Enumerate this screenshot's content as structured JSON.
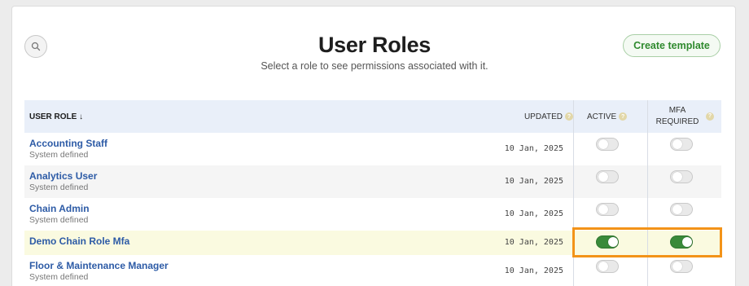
{
  "header": {
    "title": "User Roles",
    "subtitle": "Select a role to see permissions associated with it.",
    "create_label": "Create template"
  },
  "table": {
    "col_role": "USER ROLE ↓",
    "col_updated": "UPDATED",
    "col_active": "ACTIVE",
    "col_mfa_line1": "MFA",
    "col_mfa_line2": "REQUIRED",
    "help_glyph": "?",
    "rows": [
      {
        "name": "Accounting Staff",
        "sub": "System defined",
        "updated": "10 Jan, 2025",
        "active": false,
        "mfa": false
      },
      {
        "name": "Analytics User",
        "sub": "System defined",
        "updated": "10 Jan, 2025",
        "active": false,
        "mfa": false
      },
      {
        "name": "Chain Admin",
        "sub": "System defined",
        "updated": "10 Jan, 2025",
        "active": false,
        "mfa": false
      },
      {
        "name": "Demo Chain Role Mfa",
        "sub": "",
        "updated": "10 Jan, 2025",
        "active": true,
        "mfa": true
      },
      {
        "name": "Floor & Maintenance Manager",
        "sub": "System defined",
        "updated": "10 Jan, 2025",
        "active": false,
        "mfa": false
      }
    ]
  },
  "colors": {
    "accent_green": "#2f8a2e",
    "link_blue": "#2d5ba6",
    "highlight_orange": "#f39318",
    "header_bg": "#e9eff9"
  },
  "icons": {
    "search": "search-icon"
  }
}
